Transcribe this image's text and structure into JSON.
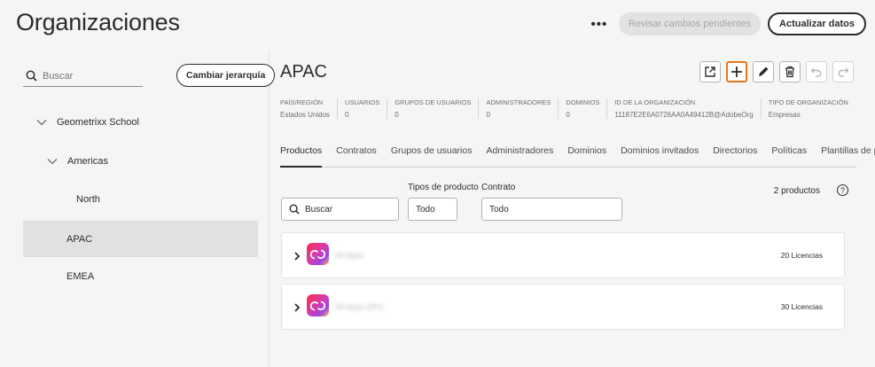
{
  "header": {
    "title": "Organizaciones",
    "more_label": "•••",
    "pending_label": "Revisar cambios pendientes",
    "refresh_label": "Actualizar datos"
  },
  "left": {
    "search_placeholder": "Buscar",
    "hierarchy_button": "Cambiar jerarquía",
    "tree": [
      {
        "label": "Geometrixx School",
        "level": 0,
        "expanded": true
      },
      {
        "label": "Americas",
        "level": 1,
        "expanded": true
      },
      {
        "label": "North",
        "level": 2
      },
      {
        "label": "APAC",
        "level": 1,
        "selected": true
      },
      {
        "label": "EMEA",
        "level": 1
      }
    ]
  },
  "org": {
    "name": "APAC",
    "meta": [
      {
        "label": "PAÍS/REGIÓN",
        "value": "Estados Unidos"
      },
      {
        "label": "USUARIOS",
        "value": "0"
      },
      {
        "label": "GRUPOS DE USUARIOS",
        "value": "0"
      },
      {
        "label": "ADMINISTRADORES",
        "value": "0"
      },
      {
        "label": "DOMINIOS",
        "value": "0"
      },
      {
        "label": "ID DE LA ORGANIZACIÓN",
        "value": "11187E2E6A0726AA0A49412B@AdobeOrg"
      },
      {
        "label": "TIPO DE ORGANIZACIÓN",
        "value": "Empresas"
      }
    ]
  },
  "tabs": [
    "Productos",
    "Contratos",
    "Grupos de usuarios",
    "Administradores",
    "Dominios",
    "Dominios invitados",
    "Directorios",
    "Políticas",
    "Plantillas de política"
  ],
  "filters": {
    "search_placeholder": "Buscar",
    "product_type_label": "Tipos de producto",
    "product_type_value": "Todo",
    "contract_label": "Contrato",
    "contract_value": "Todo",
    "count": "2 productos",
    "help": "?"
  },
  "products": [
    {
      "name": "All Apps",
      "licenses": "20 Licencias"
    },
    {
      "name": "All Apps (DH)",
      "licenses": "30 Licencias"
    }
  ],
  "colors": {
    "accent": "#e5761f",
    "selected_bg": "#e1e1e1"
  }
}
